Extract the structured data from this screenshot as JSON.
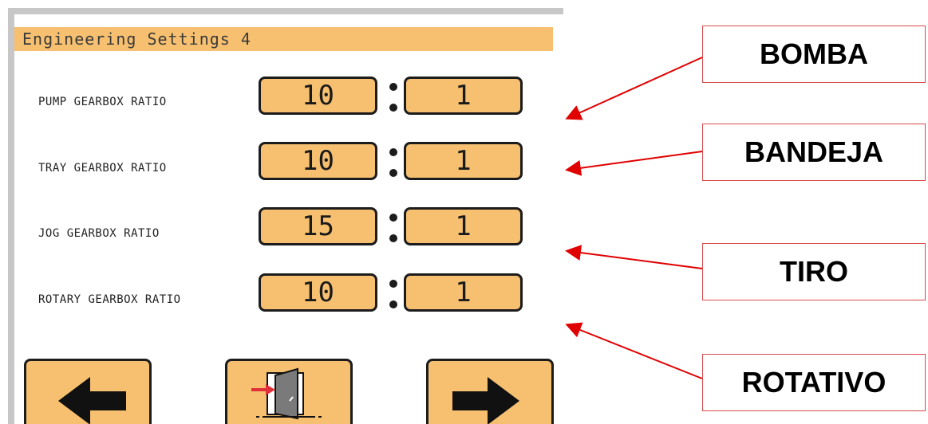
{
  "screen": {
    "title": "Engineering Settings 4",
    "rows": [
      {
        "label": "PUMP GEARBOX RATIO",
        "left": "10",
        "right": "1"
      },
      {
        "label": "TRAY GEARBOX RATIO",
        "left": "10",
        "right": "1"
      },
      {
        "label": "JOG GEARBOX RATIO",
        "left": "15",
        "right": "1"
      },
      {
        "label": "ROTARY GEARBOX RATIO",
        "left": "10",
        "right": "1"
      }
    ],
    "nav": {
      "prev_icon": "arrow-left-icon",
      "exit_icon": "exit-door-icon",
      "next_icon": "arrow-right-icon"
    }
  },
  "callouts": [
    "BOMBA",
    "BANDEJA",
    "TIRO",
    "ROTATIVO"
  ],
  "colors": {
    "accent": "#f6c070",
    "frame": "#c7c7c7",
    "annotation": "#e00000"
  }
}
